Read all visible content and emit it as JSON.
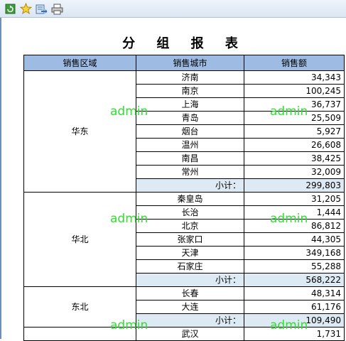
{
  "toolbar": {
    "buttons": [
      {
        "icon": "refresh-icon"
      },
      {
        "icon": "star-icon"
      },
      {
        "icon": "export-icon"
      },
      {
        "icon": "print-icon"
      }
    ]
  },
  "report": {
    "title": "分 组 报 表",
    "headers": {
      "region": "销售区域",
      "city": "销售城市",
      "amount": "销售额"
    },
    "subtotal_label": "小计：",
    "groups": [
      {
        "region": "华东",
        "rows": [
          {
            "city": "济南",
            "amount": "34,343"
          },
          {
            "city": "南京",
            "amount": "100,245"
          },
          {
            "city": "上海",
            "amount": "36,737"
          },
          {
            "city": "青岛",
            "amount": "25,509"
          },
          {
            "city": "烟台",
            "amount": "5,927"
          },
          {
            "city": "温州",
            "amount": "26,608"
          },
          {
            "city": "南昌",
            "amount": "38,425"
          },
          {
            "city": "常州",
            "amount": "32,009"
          }
        ],
        "subtotal": "299,803"
      },
      {
        "region": "华北",
        "rows": [
          {
            "city": "秦皇岛",
            "amount": "31,205"
          },
          {
            "city": "长治",
            "amount": "1,444"
          },
          {
            "city": "北京",
            "amount": "86,812"
          },
          {
            "city": "张家口",
            "amount": "44,305"
          },
          {
            "city": "天津",
            "amount": "349,168"
          },
          {
            "city": "石家庄",
            "amount": "55,288"
          }
        ],
        "subtotal": "568,222"
      },
      {
        "region": "东北",
        "rows": [
          {
            "city": "长春",
            "amount": "48,314"
          },
          {
            "city": "大连",
            "amount": "61,176"
          }
        ],
        "subtotal": "109,490"
      },
      {
        "region": "",
        "rows": [
          {
            "city": "武汉",
            "amount": "1,731"
          }
        ]
      }
    ]
  },
  "watermark": {
    "text": "admin",
    "color": "#2fe02f"
  }
}
